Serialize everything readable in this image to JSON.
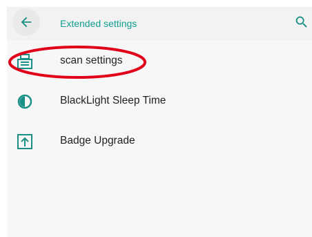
{
  "appbar": {
    "title": "Extended settings",
    "back_icon": "arrow-back-icon",
    "search_icon": "search-icon",
    "accent_color": "#119e91"
  },
  "settings": {
    "items": [
      {
        "label": "scan settings",
        "icon": "scanner-icon"
      },
      {
        "label": "BlackLight Sleep Time",
        "icon": "brightness-icon"
      },
      {
        "label": "Badge Upgrade",
        "icon": "upgrade-icon"
      }
    ]
  },
  "annotation": {
    "color": "#e0001a",
    "target": "scan settings"
  }
}
